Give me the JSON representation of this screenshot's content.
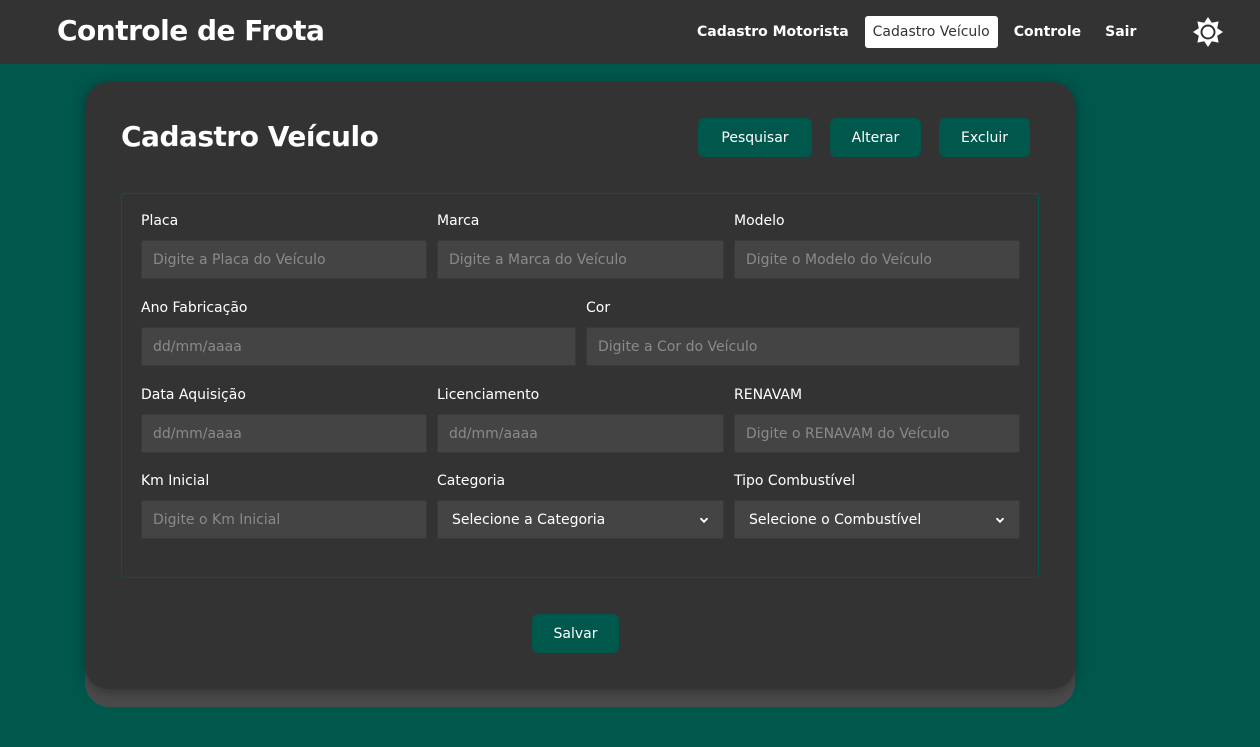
{
  "app": {
    "title": "Controle de Frota"
  },
  "nav": {
    "items": [
      {
        "label": "Cadastro Motorista",
        "active": false
      },
      {
        "label": "Cadastro Veículo",
        "active": true
      },
      {
        "label": "Controle",
        "active": false
      },
      {
        "label": "Sair",
        "active": false
      }
    ],
    "theme_icon": "sun-icon"
  },
  "page": {
    "title": "Cadastro Veículo",
    "actions": {
      "search": "Pesquisar",
      "edit": "Alterar",
      "delete": "Excluir"
    },
    "save": "Salvar"
  },
  "form": {
    "placa": {
      "label": "Placa",
      "placeholder": "Digite a Placa do Veículo",
      "value": ""
    },
    "marca": {
      "label": "Marca",
      "placeholder": "Digite a Marca do Veículo",
      "value": ""
    },
    "modelo": {
      "label": "Modelo",
      "placeholder": "Digite o Modelo do Veículo",
      "value": ""
    },
    "ano": {
      "label": "Ano Fabricação",
      "placeholder": "dd/mm/aaaa",
      "value": ""
    },
    "cor": {
      "label": "Cor",
      "placeholder": "Digite a Cor do Veículo",
      "value": ""
    },
    "aquisicao": {
      "label": "Data Aquisição",
      "placeholder": "dd/mm/aaaa",
      "value": ""
    },
    "licenciamento": {
      "label": "Licenciamento",
      "placeholder": "dd/mm/aaaa",
      "value": ""
    },
    "renavam": {
      "label": "RENAVAM",
      "placeholder": "Digite o RENAVAM do Veículo",
      "value": ""
    },
    "km": {
      "label": "Km Inicial",
      "placeholder": "Digite o Km Inicial",
      "value": ""
    },
    "categoria": {
      "label": "Categoria",
      "selected": "Selecione a Categoria"
    },
    "combustivel": {
      "label": "Tipo Combustível",
      "selected": "Selecione o Combustível"
    }
  },
  "colors": {
    "background": "#00574c",
    "surface": "#333333",
    "input": "#444444",
    "accent": "#00574c"
  }
}
